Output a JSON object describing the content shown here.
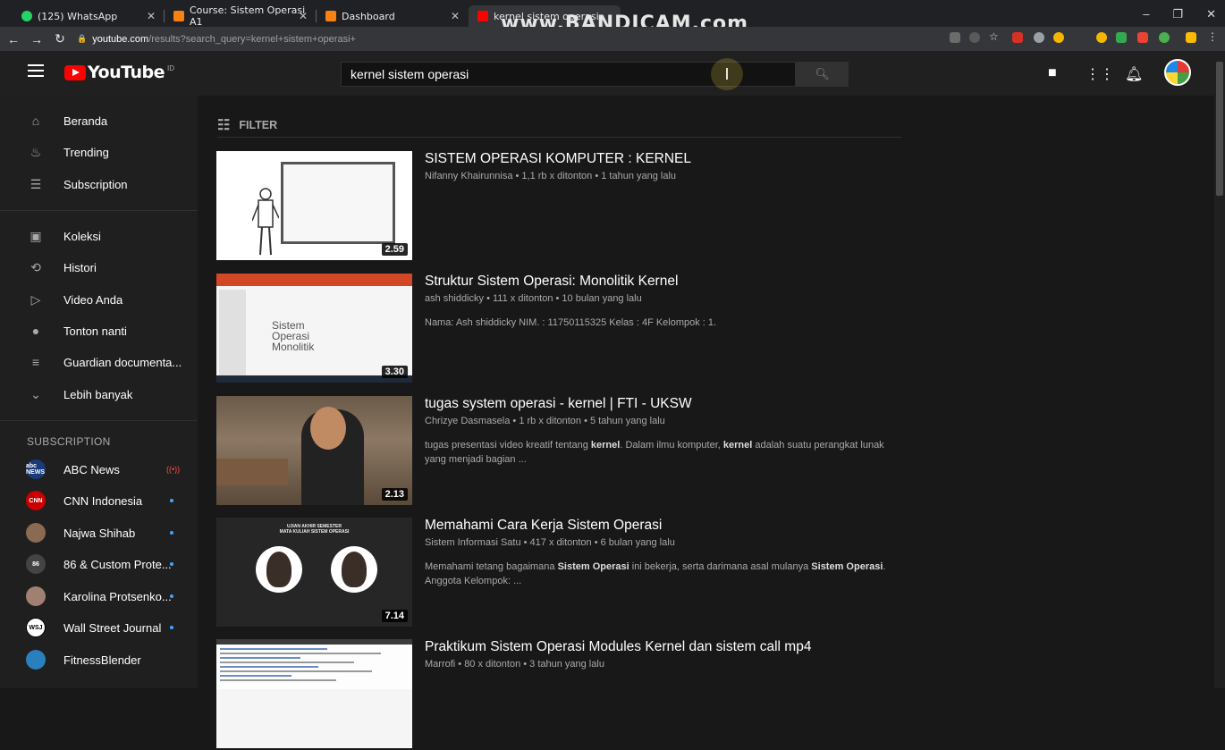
{
  "browser": {
    "tabs": [
      {
        "title": "(125) WhatsApp"
      },
      {
        "title": "Course: Sistem Operasi A1"
      },
      {
        "title": "Dashboard"
      },
      {
        "title": "kernel sistem operasi"
      }
    ],
    "url_host": "youtube.com",
    "url_path": "/results?search_query=kernel+sistem+operasi+",
    "watermark": "www.BANDICAM.com"
  },
  "masthead": {
    "logo_text": "YouTube",
    "country": "ID",
    "search_value": "kernel sistem operasi"
  },
  "sidebar": {
    "main": [
      {
        "label": "Beranda",
        "icon": "home-icon"
      },
      {
        "label": "Trending",
        "icon": "flame-icon"
      },
      {
        "label": "Subscription",
        "icon": "subscriptions-icon"
      }
    ],
    "library": [
      {
        "label": "Koleksi",
        "icon": "library-icon"
      },
      {
        "label": "Histori",
        "icon": "history-icon"
      },
      {
        "label": "Video Anda",
        "icon": "your-videos-icon"
      },
      {
        "label": "Tonton nanti",
        "icon": "watch-later-icon"
      },
      {
        "label": "Guardian documenta...",
        "icon": "playlist-icon"
      },
      {
        "label": "Lebih banyak",
        "icon": "chevron-down-icon"
      }
    ],
    "subscription_heading": "SUBSCRIPTION",
    "subscriptions": [
      {
        "label": "ABC News",
        "badge": "live",
        "color": "#1a3a7a",
        "initials": "abc NEWS"
      },
      {
        "label": "CNN Indonesia",
        "badge": "dot",
        "color": "#cc0000",
        "initials": "CNN"
      },
      {
        "label": "Najwa Shihab",
        "badge": "dot",
        "color": "#8a6a50",
        "initials": ""
      },
      {
        "label": "86 & Custom Prote...",
        "badge": "dot",
        "color": "#444444",
        "initials": "86"
      },
      {
        "label": "Karolina Protsenko...",
        "badge": "dot",
        "color": "#a08070",
        "initials": ""
      },
      {
        "label": "Wall Street Journal",
        "badge": "dot",
        "color": "#ffffff",
        "initials": "WSJ"
      },
      {
        "label": "FitnessBlender",
        "badge": "",
        "color": "#2a7fbf",
        "initials": ""
      }
    ]
  },
  "filter_label": "FILTER",
  "results": [
    {
      "title": "SISTEM OPERASI KOMPUTER : KERNEL",
      "meta": "Nifanny Khairunnisa • 1,1 rb x ditonton • 1 tahun yang lalu",
      "desc_html": "",
      "duration": "2.59"
    },
    {
      "title": "Struktur Sistem Operasi: Monolitik Kernel",
      "meta": "ash shiddicky • 111 x ditonton • 10 bulan yang lalu",
      "desc_html": "Nama: Ash shiddicky NIM. : 11750115325 Kelas : 4F Kelompok : 1.",
      "duration": "3.30",
      "thumb_text": "Sistem Operasi Monolitik"
    },
    {
      "title": "tugas system operasi - kernel | FTI - UKSW",
      "meta": "Chrizye Dasmasela • 1 rb x ditonton • 5 tahun yang lalu",
      "desc_html": "tugas presentasi video kreatif tentang <b>kernel</b>. Dalam ilmu komputer, <b>kernel</b> adalah suatu perangkat lunak yang menjadi bagian ...",
      "duration": "2.13"
    },
    {
      "title": "Memahami Cara Kerja Sistem Operasi",
      "meta": "Sistem Informasi Satu • 417 x ditonton • 6 bulan yang lalu",
      "desc_html": "Memahami tetang bagaimana <b>Sistem Operasi</b> ini bekerja, serta darimana asal mulanya <b>Sistem Operasi</b>. Anggota Kelompok: ...",
      "duration": "7.14",
      "thumb_text_1": "UJIAN AKHIR SEMESTER",
      "thumb_text_2": "MATA KULIAH SISTEM OPERASI"
    },
    {
      "title": "Praktikum Sistem Operasi Modules Kernel dan sistem call mp4",
      "meta": "Marrofi • 80 x ditonton • 3 tahun yang lalu",
      "desc_html": "",
      "duration": ""
    }
  ]
}
